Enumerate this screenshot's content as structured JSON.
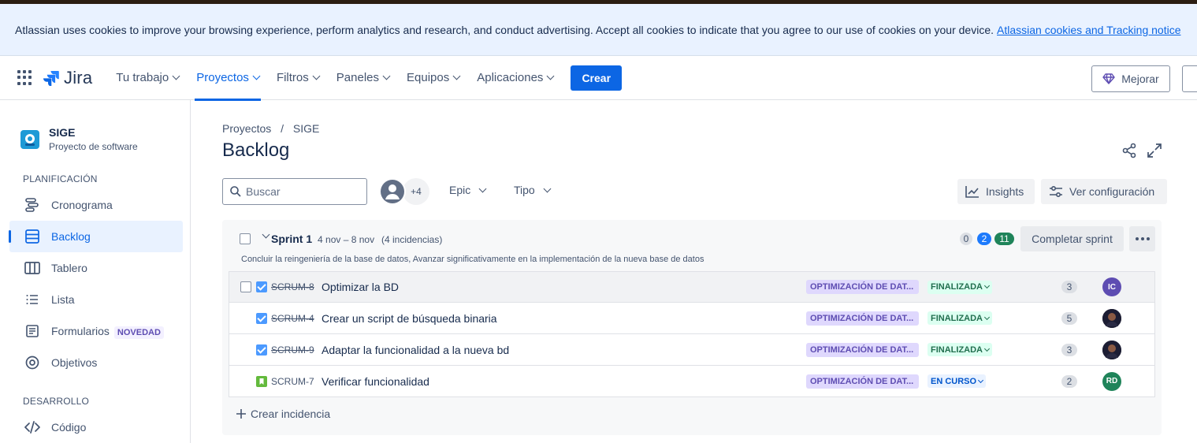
{
  "cookie_banner": {
    "text": "Atlassian uses cookies to improve your browsing experience, perform analytics and research, and conduct advertising. Accept all cookies to indicate that you agree to our use of cookies on your device.",
    "link": "Atlassian cookies and Tracking notice"
  },
  "nav": {
    "logo": "Jira",
    "items": [
      "Tu trabajo",
      "Proyectos",
      "Filtros",
      "Paneles",
      "Equipos",
      "Aplicaciones"
    ],
    "active": "Proyectos",
    "create": "Crear",
    "upgrade": "Mejorar"
  },
  "sidebar": {
    "project_name": "SIGE",
    "project_type": "Proyecto de software",
    "section_planning": "PLANIFICACIÓN",
    "section_dev": "DESARROLLO",
    "items": [
      {
        "label": "Cronograma",
        "icon": "timeline-icon"
      },
      {
        "label": "Backlog",
        "icon": "backlog-icon",
        "active": true
      },
      {
        "label": "Tablero",
        "icon": "board-icon"
      },
      {
        "label": "Lista",
        "icon": "list-icon"
      },
      {
        "label": "Formularios",
        "icon": "forms-icon",
        "badge": "NOVEDAD"
      },
      {
        "label": "Objetivos",
        "icon": "goals-icon"
      },
      {
        "label": "Código",
        "icon": "code-icon"
      }
    ]
  },
  "page": {
    "breadcrumb": [
      "Proyectos",
      "SIGE"
    ],
    "title": "Backlog"
  },
  "toolbar": {
    "search_placeholder": "Buscar",
    "avatar_more": "+4",
    "epic": "Epic",
    "type": "Tipo",
    "insights": "Insights",
    "settings": "Ver configuración"
  },
  "sprint": {
    "name": "Sprint 1",
    "dates": "4 nov – 8 nov",
    "count": "(4 incidencias)",
    "goal": "Concluir la reingeniería de la base de datos, Avanzar significativamente en la implementación de la nueva base de datos",
    "counts": {
      "todo": "0",
      "in_progress": "2",
      "done": "11"
    },
    "complete": "Completar sprint",
    "create_issue": "Crear incidencia"
  },
  "issues": [
    {
      "key": "SCRUM-8",
      "summary": "Optimizar la BD",
      "epic": "OPTIMIZACIÓN DE DAT...",
      "status": "FINALIZADA",
      "points": "3",
      "assignee": "IC",
      "done": true
    },
    {
      "key": "SCRUM-4",
      "summary": "Crear un script de búsqueda binaria",
      "epic": "OPTIMIZACIÓN DE DAT...",
      "status": "FINALIZADA",
      "points": "5",
      "assignee": "",
      "done": true
    },
    {
      "key": "SCRUM-9",
      "summary": "Adaptar la funcionalidad a la nueva bd",
      "epic": "OPTIMIZACIÓN DE DAT...",
      "status": "FINALIZADA",
      "points": "3",
      "assignee": "",
      "done": true
    },
    {
      "key": "SCRUM-7",
      "summary": "Verificar funcionalidad",
      "epic": "OPTIMIZACIÓN DE DAT...",
      "status": "EN CURSO",
      "points": "2",
      "assignee": "RD",
      "done": false
    }
  ],
  "colors": {
    "accent": "#0c66e4",
    "epic_bg": "#dfd8fd",
    "done_status": "#216e4e",
    "avatar_ic": "#5e4db2",
    "avatar_rd": "#1f845a"
  }
}
